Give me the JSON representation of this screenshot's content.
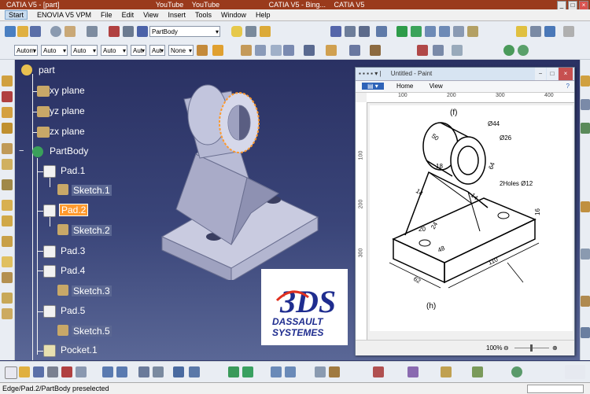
{
  "window": {
    "title": "CATIA V5 - [part]",
    "taskbar": [
      "YouTube",
      "YouTube",
      "CATIA V5 - Bing...",
      "CATIA V5"
    ]
  },
  "menu": {
    "start": "Start",
    "items": [
      "ENOVIA V5 VPM",
      "File",
      "Edit",
      "View",
      "Insert",
      "Tools",
      "Window",
      "Help"
    ]
  },
  "toolbar": {
    "body_selector": "PartBody",
    "combos": [
      "Autom",
      "Auto",
      "Auto",
      "Auto",
      "Aut",
      "Aut",
      "None"
    ]
  },
  "tree": {
    "root": "part",
    "planes": [
      "xy plane",
      "yz plane",
      "zx plane"
    ],
    "body": "PartBody",
    "features": [
      {
        "label": "Pad.1",
        "sketch": "Sketch.1",
        "highlighted": false
      },
      {
        "label": "Pad.2",
        "sketch": "Sketch.2",
        "highlighted": true
      },
      {
        "label": "Pad.3",
        "sketch": null,
        "highlighted": false
      },
      {
        "label": "Pad.4",
        "sketch": "Sketch.3",
        "highlighted": false
      },
      {
        "label": "Pad.5",
        "sketch": "Sketch.5",
        "highlighted": false
      },
      {
        "label": "Pocket.1",
        "sketch": null,
        "highlighted": false
      }
    ]
  },
  "paint": {
    "title": "Untitled - Paint",
    "tabs": [
      "Home",
      "View"
    ],
    "ruler_h": [
      "100",
      "200",
      "300",
      "400"
    ],
    "ruler_v": [
      "100",
      "200",
      "300"
    ],
    "zoom": "100%",
    "drawing": {
      "label_top": "(f)",
      "label_bottom": "(h)",
      "dims": [
        "Ø44",
        "Ø26",
        "50",
        "64",
        "18",
        "14",
        "14",
        "2Holes Ø12",
        "16",
        "24",
        "20",
        "48",
        "110",
        "62"
      ]
    }
  },
  "logo": {
    "line1": "DASSAULT",
    "line2": "SYSTEMES",
    "mark": "3DS"
  },
  "status": {
    "text": "Edge/Pad.2/PartBody preselected"
  },
  "colors": {
    "workspace_top": "#2a3163",
    "workspace_bottom": "#5a6796",
    "highlight": "#ff9a2e",
    "logo_blue": "#1f2d8f"
  }
}
